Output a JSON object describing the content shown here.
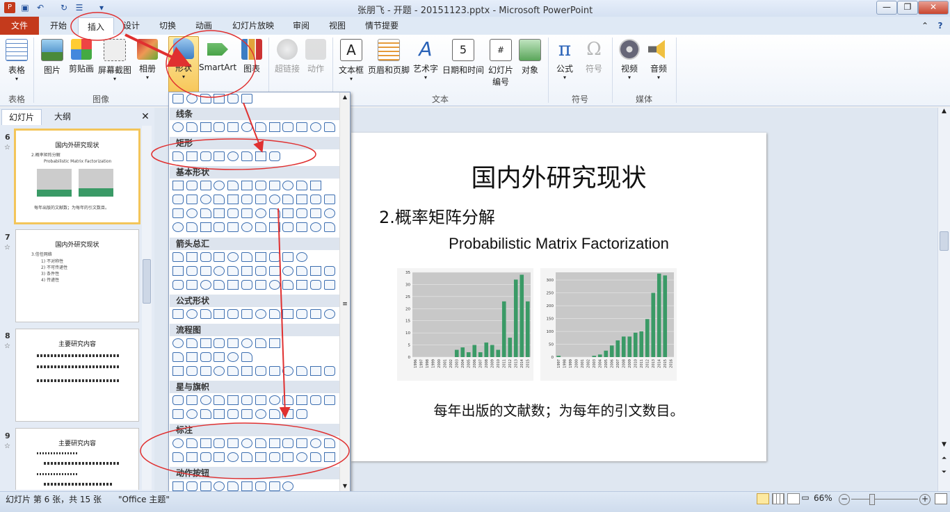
{
  "app": {
    "title": "张朋飞 - 开题 - 20151123.pptx - Microsoft PowerPoint"
  },
  "tabs": [
    "文件",
    "开始",
    "插入",
    "设计",
    "切换",
    "动画",
    "幻灯片放映",
    "审阅",
    "视图",
    "情节提要"
  ],
  "active_tab": "插入",
  "ribbon": {
    "buttons": {
      "table": "表格",
      "picture": "图片",
      "clipart": "剪贴画",
      "screenshot": "屏幕截图",
      "album": "相册",
      "shapes": "形状",
      "smartart": "SmartArt",
      "chart": "图表",
      "hyperlink": "超链接",
      "action": "动作",
      "textbox": "文本框",
      "headerfooter": "页眉和页脚",
      "wordart": "艺术字",
      "datetime": "日期和时间",
      "slidenum1": "幻灯片",
      "slidenum2": "编号",
      "object": "对象",
      "equation": "公式",
      "symbol": "符号",
      "video": "视频",
      "audio": "音频"
    },
    "groups": {
      "tables": "表格",
      "images": "图像",
      "text": "文本",
      "symbols": "符号",
      "media": "媒体"
    }
  },
  "panel_tabs": {
    "slides": "幻灯片",
    "outline": "大纲"
  },
  "thumbnails": [
    {
      "num": "6",
      "title": "国内外研究现状",
      "lines": [
        "2.概率矩阵分解",
        "Probabilistic Matrix Factorization",
        "每年出版的文献数；为每年的引文数目。"
      ]
    },
    {
      "num": "7",
      "title": "国内外研究现状",
      "lines": [
        "3.信任网络",
        "1) 不对称性",
        "2) 不可传递性",
        "3) 条件性",
        "4) 传递性"
      ]
    },
    {
      "num": "8",
      "title": "主要研究内容",
      "lines": []
    },
    {
      "num": "9",
      "title": "主要研究内容",
      "lines": []
    }
  ],
  "gallery": {
    "headers": {
      "lines": "线条",
      "rectangles": "矩形",
      "basic": "基本形状",
      "arrows": "箭头总汇",
      "equation": "公式形状",
      "flowchart": "流程图",
      "stars": "星与旗帜",
      "callouts": "标注",
      "action": "动作按钮"
    }
  },
  "slide": {
    "title": "国内外研究现状",
    "subtitle": "2.概率矩阵分解",
    "english": "Probabilistic Matrix Factorization",
    "caption": "每年出版的文献数；为每年的引文数目。"
  },
  "chart_data": [
    {
      "type": "bar",
      "color": "#3a9a66",
      "categories": [
        "1996",
        "1997",
        "1998",
        "1999",
        "2000",
        "2001",
        "2002",
        "2003",
        "2004",
        "2005",
        "2006",
        "2007",
        "2008",
        "2009",
        "2010",
        "2011",
        "2012",
        "2013",
        "2014",
        "2015"
      ],
      "values": [
        0,
        0,
        0,
        0,
        0,
        0,
        0,
        3,
        4,
        2,
        5,
        2,
        6,
        5,
        3,
        23,
        8,
        32,
        34,
        23
      ],
      "ylim": [
        0,
        35
      ],
      "yticks": [
        "0",
        "5",
        "10",
        "15",
        "20",
        "25",
        "30",
        "35"
      ]
    },
    {
      "type": "bar",
      "color": "#3a9a66",
      "categories": [
        "1997",
        "1998",
        "1999",
        "2000",
        "2001",
        "2002",
        "2003",
        "2004",
        "2005",
        "2006",
        "2007",
        "2008",
        "2009",
        "2010",
        "2011",
        "2012",
        "2013",
        "2014",
        "2015",
        "2016"
      ],
      "values": [
        5,
        0,
        0,
        0,
        0,
        0,
        5,
        10,
        25,
        45,
        65,
        80,
        80,
        95,
        100,
        148,
        250,
        325,
        318,
        0
      ],
      "ylim": [
        0,
        330
      ],
      "yticks": [
        "0",
        "50",
        "100",
        "150",
        "200",
        "250",
        "300"
      ]
    }
  ],
  "status": {
    "slide_info": "幻灯片 第 6 张，共 15 张",
    "theme": "\"Office 主题\"",
    "zoom": "66%"
  },
  "colors": {
    "file_tab": "#c43a1c",
    "annotation": "#e03030",
    "bar": "#3a9a66"
  }
}
